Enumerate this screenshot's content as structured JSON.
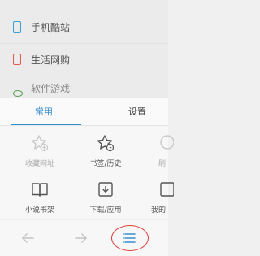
{
  "background_list": {
    "items": [
      {
        "label": "手机酷站",
        "icon": "phone-icon"
      },
      {
        "label": "生活网购",
        "icon": "shopping-icon"
      },
      {
        "label": "软件游戏",
        "icon": "game-icon"
      }
    ]
  },
  "sheet": {
    "tabs": [
      {
        "label": "常用",
        "active": true
      },
      {
        "label": "设置",
        "active": false
      }
    ],
    "grid": [
      {
        "label": "收藏网址",
        "icon": "star-plus-icon",
        "enabled": false
      },
      {
        "label": "书签/历史",
        "icon": "star-clock-icon",
        "enabled": true
      },
      {
        "label": "刷",
        "icon": "refresh-icon",
        "enabled": false
      },
      {
        "label": "小说书架",
        "icon": "book-icon",
        "enabled": true
      },
      {
        "label": "下载/应用",
        "icon": "download-icon",
        "enabled": true
      },
      {
        "label": "我的",
        "icon": "my-icon",
        "enabled": true
      }
    ],
    "navbar": {
      "back_icon": "arrow-left-icon",
      "forward_icon": "arrow-right-icon",
      "menu_icon": "menu-icon"
    }
  },
  "colors": {
    "accent": "#3a8fd0",
    "highlight": "#e04040"
  }
}
